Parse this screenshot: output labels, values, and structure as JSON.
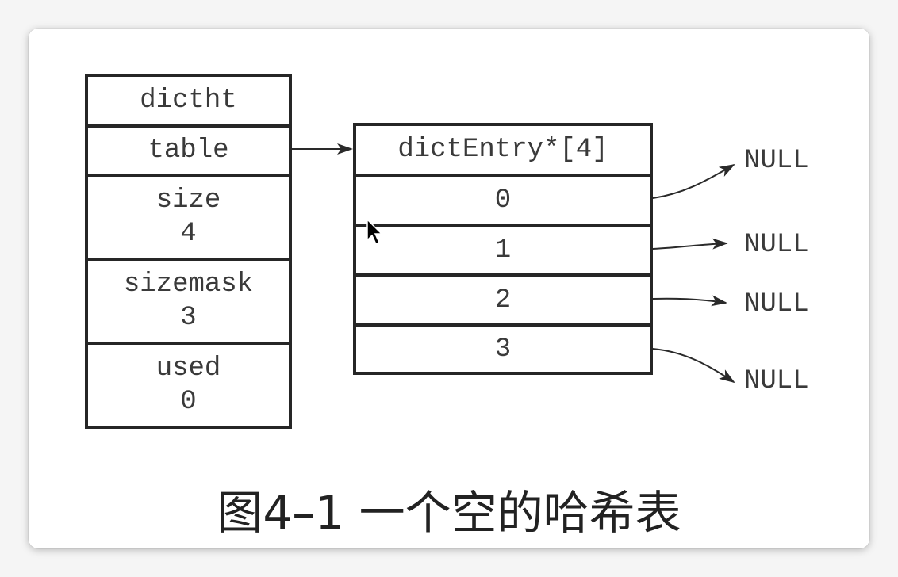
{
  "dictht": {
    "title": "dictht",
    "table": "table",
    "size_label": "size",
    "size_value": "4",
    "sizemask_label": "sizemask",
    "sizemask_value": "3",
    "used_label": "used",
    "used_value": "0"
  },
  "entries": {
    "header": "dictEntry*[4]",
    "rows": [
      "0",
      "1",
      "2",
      "3"
    ]
  },
  "nulls": [
    "NULL",
    "NULL",
    "NULL",
    "NULL"
  ],
  "caption": "图4–1 一个空的哈希表"
}
